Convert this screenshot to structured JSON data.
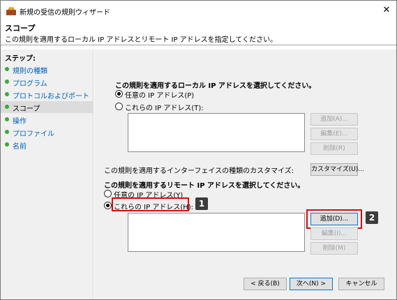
{
  "window": {
    "title": "新規の受信の規則ウィザード",
    "close_icon": "✕"
  },
  "header": {
    "title": "スコープ",
    "description": "この規則を適用するローカル IP アドレスとリモート IP アドレスを指定してください。"
  },
  "sidebar": {
    "heading": "ステップ:",
    "items": [
      {
        "label": "規則の種類"
      },
      {
        "label": "プログラム"
      },
      {
        "label": "プロトコルおよびポート"
      },
      {
        "label": "スコープ"
      },
      {
        "label": "操作"
      },
      {
        "label": "プロファイル"
      },
      {
        "label": "名前"
      }
    ]
  },
  "local": {
    "title": "この規則を適用するローカル IP アドレスを選択してください。",
    "radio_any": "任意の IP アドレス(P)",
    "radio_these": "これらの IP アドレス(T):",
    "selected": "any",
    "add": "追加(A)...",
    "edit": "編集(E)...",
    "remove": "削除(R)"
  },
  "interface": {
    "label": "この規則を適用するインターフェイスの種類のカスタマイズ:",
    "button": "カスタマイズ(U)..."
  },
  "remote": {
    "title": "この規則を適用するリモート IP アドレスを選択してください。",
    "radio_any": "任意の IP アドレス(Y)",
    "radio_these": "これらの IP アドレス(H):",
    "selected": "these",
    "add": "追加(D)...",
    "edit": "編集(I)...",
    "remove": "削除(M)"
  },
  "footer": {
    "back": "< 戻る(B)",
    "next": "次へ(N) >",
    "cancel": "キャンセル"
  },
  "callouts": [
    "1",
    "2"
  ],
  "colors": {
    "accent": "#0078d7",
    "highlight": "#d01010",
    "step_dot": "#3aa83a",
    "link": "#0060c0"
  }
}
